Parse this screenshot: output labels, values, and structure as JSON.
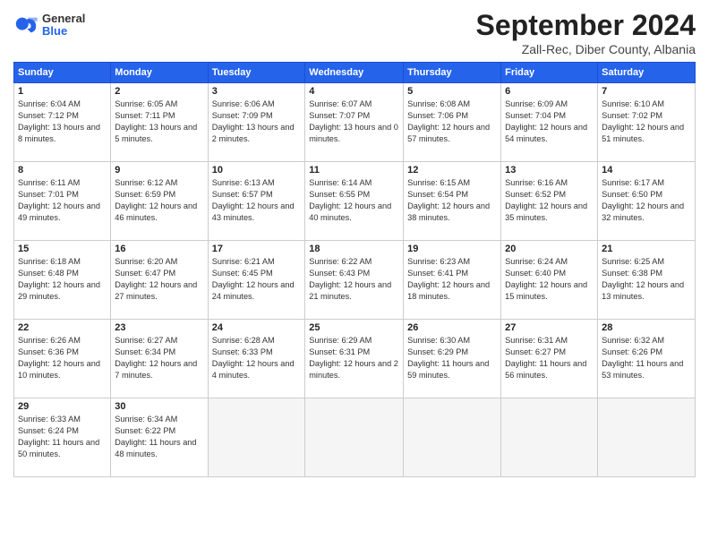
{
  "header": {
    "logo_general": "General",
    "logo_blue": "Blue",
    "month_title": "September 2024",
    "subtitle": "Zall-Rec, Diber County, Albania"
  },
  "weekdays": [
    "Sunday",
    "Monday",
    "Tuesday",
    "Wednesday",
    "Thursday",
    "Friday",
    "Saturday"
  ],
  "weeks": [
    [
      {
        "day": "1",
        "sunrise": "Sunrise: 6:04 AM",
        "sunset": "Sunset: 7:12 PM",
        "daylight": "Daylight: 13 hours and 8 minutes."
      },
      {
        "day": "2",
        "sunrise": "Sunrise: 6:05 AM",
        "sunset": "Sunset: 7:11 PM",
        "daylight": "Daylight: 13 hours and 5 minutes."
      },
      {
        "day": "3",
        "sunrise": "Sunrise: 6:06 AM",
        "sunset": "Sunset: 7:09 PM",
        "daylight": "Daylight: 13 hours and 2 minutes."
      },
      {
        "day": "4",
        "sunrise": "Sunrise: 6:07 AM",
        "sunset": "Sunset: 7:07 PM",
        "daylight": "Daylight: 13 hours and 0 minutes."
      },
      {
        "day": "5",
        "sunrise": "Sunrise: 6:08 AM",
        "sunset": "Sunset: 7:06 PM",
        "daylight": "Daylight: 12 hours and 57 minutes."
      },
      {
        "day": "6",
        "sunrise": "Sunrise: 6:09 AM",
        "sunset": "Sunset: 7:04 PM",
        "daylight": "Daylight: 12 hours and 54 minutes."
      },
      {
        "day": "7",
        "sunrise": "Sunrise: 6:10 AM",
        "sunset": "Sunset: 7:02 PM",
        "daylight": "Daylight: 12 hours and 51 minutes."
      }
    ],
    [
      {
        "day": "8",
        "sunrise": "Sunrise: 6:11 AM",
        "sunset": "Sunset: 7:01 PM",
        "daylight": "Daylight: 12 hours and 49 minutes."
      },
      {
        "day": "9",
        "sunrise": "Sunrise: 6:12 AM",
        "sunset": "Sunset: 6:59 PM",
        "daylight": "Daylight: 12 hours and 46 minutes."
      },
      {
        "day": "10",
        "sunrise": "Sunrise: 6:13 AM",
        "sunset": "Sunset: 6:57 PM",
        "daylight": "Daylight: 12 hours and 43 minutes."
      },
      {
        "day": "11",
        "sunrise": "Sunrise: 6:14 AM",
        "sunset": "Sunset: 6:55 PM",
        "daylight": "Daylight: 12 hours and 40 minutes."
      },
      {
        "day": "12",
        "sunrise": "Sunrise: 6:15 AM",
        "sunset": "Sunset: 6:54 PM",
        "daylight": "Daylight: 12 hours and 38 minutes."
      },
      {
        "day": "13",
        "sunrise": "Sunrise: 6:16 AM",
        "sunset": "Sunset: 6:52 PM",
        "daylight": "Daylight: 12 hours and 35 minutes."
      },
      {
        "day": "14",
        "sunrise": "Sunrise: 6:17 AM",
        "sunset": "Sunset: 6:50 PM",
        "daylight": "Daylight: 12 hours and 32 minutes."
      }
    ],
    [
      {
        "day": "15",
        "sunrise": "Sunrise: 6:18 AM",
        "sunset": "Sunset: 6:48 PM",
        "daylight": "Daylight: 12 hours and 29 minutes."
      },
      {
        "day": "16",
        "sunrise": "Sunrise: 6:20 AM",
        "sunset": "Sunset: 6:47 PM",
        "daylight": "Daylight: 12 hours and 27 minutes."
      },
      {
        "day": "17",
        "sunrise": "Sunrise: 6:21 AM",
        "sunset": "Sunset: 6:45 PM",
        "daylight": "Daylight: 12 hours and 24 minutes."
      },
      {
        "day": "18",
        "sunrise": "Sunrise: 6:22 AM",
        "sunset": "Sunset: 6:43 PM",
        "daylight": "Daylight: 12 hours and 21 minutes."
      },
      {
        "day": "19",
        "sunrise": "Sunrise: 6:23 AM",
        "sunset": "Sunset: 6:41 PM",
        "daylight": "Daylight: 12 hours and 18 minutes."
      },
      {
        "day": "20",
        "sunrise": "Sunrise: 6:24 AM",
        "sunset": "Sunset: 6:40 PM",
        "daylight": "Daylight: 12 hours and 15 minutes."
      },
      {
        "day": "21",
        "sunrise": "Sunrise: 6:25 AM",
        "sunset": "Sunset: 6:38 PM",
        "daylight": "Daylight: 12 hours and 13 minutes."
      }
    ],
    [
      {
        "day": "22",
        "sunrise": "Sunrise: 6:26 AM",
        "sunset": "Sunset: 6:36 PM",
        "daylight": "Daylight: 12 hours and 10 minutes."
      },
      {
        "day": "23",
        "sunrise": "Sunrise: 6:27 AM",
        "sunset": "Sunset: 6:34 PM",
        "daylight": "Daylight: 12 hours and 7 minutes."
      },
      {
        "day": "24",
        "sunrise": "Sunrise: 6:28 AM",
        "sunset": "Sunset: 6:33 PM",
        "daylight": "Daylight: 12 hours and 4 minutes."
      },
      {
        "day": "25",
        "sunrise": "Sunrise: 6:29 AM",
        "sunset": "Sunset: 6:31 PM",
        "daylight": "Daylight: 12 hours and 2 minutes."
      },
      {
        "day": "26",
        "sunrise": "Sunrise: 6:30 AM",
        "sunset": "Sunset: 6:29 PM",
        "daylight": "Daylight: 11 hours and 59 minutes."
      },
      {
        "day": "27",
        "sunrise": "Sunrise: 6:31 AM",
        "sunset": "Sunset: 6:27 PM",
        "daylight": "Daylight: 11 hours and 56 minutes."
      },
      {
        "day": "28",
        "sunrise": "Sunrise: 6:32 AM",
        "sunset": "Sunset: 6:26 PM",
        "daylight": "Daylight: 11 hours and 53 minutes."
      }
    ],
    [
      {
        "day": "29",
        "sunrise": "Sunrise: 6:33 AM",
        "sunset": "Sunset: 6:24 PM",
        "daylight": "Daylight: 11 hours and 50 minutes."
      },
      {
        "day": "30",
        "sunrise": "Sunrise: 6:34 AM",
        "sunset": "Sunset: 6:22 PM",
        "daylight": "Daylight: 11 hours and 48 minutes."
      },
      null,
      null,
      null,
      null,
      null
    ]
  ]
}
